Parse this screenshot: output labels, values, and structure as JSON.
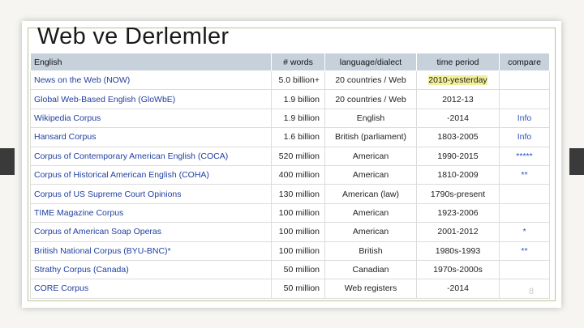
{
  "slide": {
    "title": "Web ve Derlemler",
    "page_number": "8"
  },
  "table": {
    "headers": {
      "name": "English",
      "words": "# words",
      "language": "language/dialect",
      "period": "time period",
      "compare": "compare"
    },
    "rows": [
      {
        "name": "News on the Web (NOW)",
        "words": "5.0 billion+",
        "language": "20 countries / Web",
        "period_a": "2010-",
        "period_b": "yesterday",
        "compare": ""
      },
      {
        "name": "Global Web-Based English (GloWbE)",
        "words": "1.9 billion",
        "language": "20 countries / Web",
        "period_a": "2012-13",
        "period_b": "",
        "compare": ""
      },
      {
        "name": "Wikipedia Corpus",
        "words": "1.9 billion",
        "language": "English",
        "period_a": "-2014",
        "period_b": "",
        "compare": "Info"
      },
      {
        "name": "Hansard Corpus",
        "words": "1.6 billion",
        "language": "British (parliament)",
        "period_a": "1803-2005",
        "period_b": "",
        "compare": "Info"
      },
      {
        "name": "Corpus of Contemporary American English (COCA)",
        "words": "520 million",
        "language": "American",
        "period_a": "1990-2015",
        "period_b": "",
        "compare": "*****"
      },
      {
        "name": "Corpus of Historical American English (COHA)",
        "words": "400 million",
        "language": "American",
        "period_a": "1810-2009",
        "period_b": "",
        "compare": "**"
      },
      {
        "name": "Corpus of US Supreme Court Opinions",
        "words": "130 million",
        "language": "American (law)",
        "period_a": "1790s-present",
        "period_b": "",
        "compare": ""
      },
      {
        "name": "TIME Magazine Corpus",
        "words": "100 million",
        "language": "American",
        "period_a": "1923-2006",
        "period_b": "",
        "compare": ""
      },
      {
        "name": "Corpus of American Soap Operas",
        "words": "100 million",
        "language": "American",
        "period_a": "2001-2012",
        "period_b": "",
        "compare": "*"
      },
      {
        "name": "British National Corpus (BYU-BNC)*",
        "words": "100 million",
        "language": "British",
        "period_a": "1980s-1993",
        "period_b": "",
        "compare": "**"
      },
      {
        "name": "Strathy Corpus (Canada)",
        "words": "50 million",
        "language": "Canadian",
        "period_a": "1970s-2000s",
        "period_b": "",
        "compare": ""
      },
      {
        "name": "CORE Corpus",
        "words": "50 million",
        "language": "Web registers",
        "period_a": "-2014",
        "period_b": "",
        "compare": ""
      }
    ]
  }
}
